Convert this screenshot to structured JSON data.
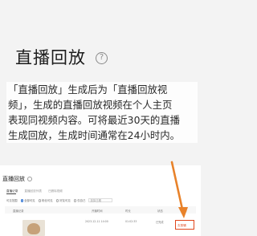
{
  "header": {
    "title": "直播回放"
  },
  "description": {
    "lines": [
      "「直播回放」生成后为「直播回放视",
      "频」，生成的直播回放视频在个人主页",
      "表现同视频内容。可将最近30天的直播",
      "生成回放，生成时间通常在24小时内。"
    ]
  },
  "panel": {
    "title": "直播回放",
    "tabs": [
      "直播记录",
      "直播回放列表",
      "已删除视频"
    ],
    "filter": {
      "label": "可见范围",
      "options": [
        "全部可见",
        "粉丝可见",
        "好友可见",
        "仅自己"
      ],
      "input_placeholder": "选择日期"
    },
    "columns": [
      "直播记录",
      "开播时间",
      "时长",
      "状态",
      "操作"
    ],
    "row": {
      "time": "2023-12-11 14:00",
      "duration": "01:02:33",
      "status": "已完成",
      "action": "去剪辑"
    }
  },
  "accent": {
    "orange": "#E8822A",
    "red_box": "#E0461C"
  }
}
